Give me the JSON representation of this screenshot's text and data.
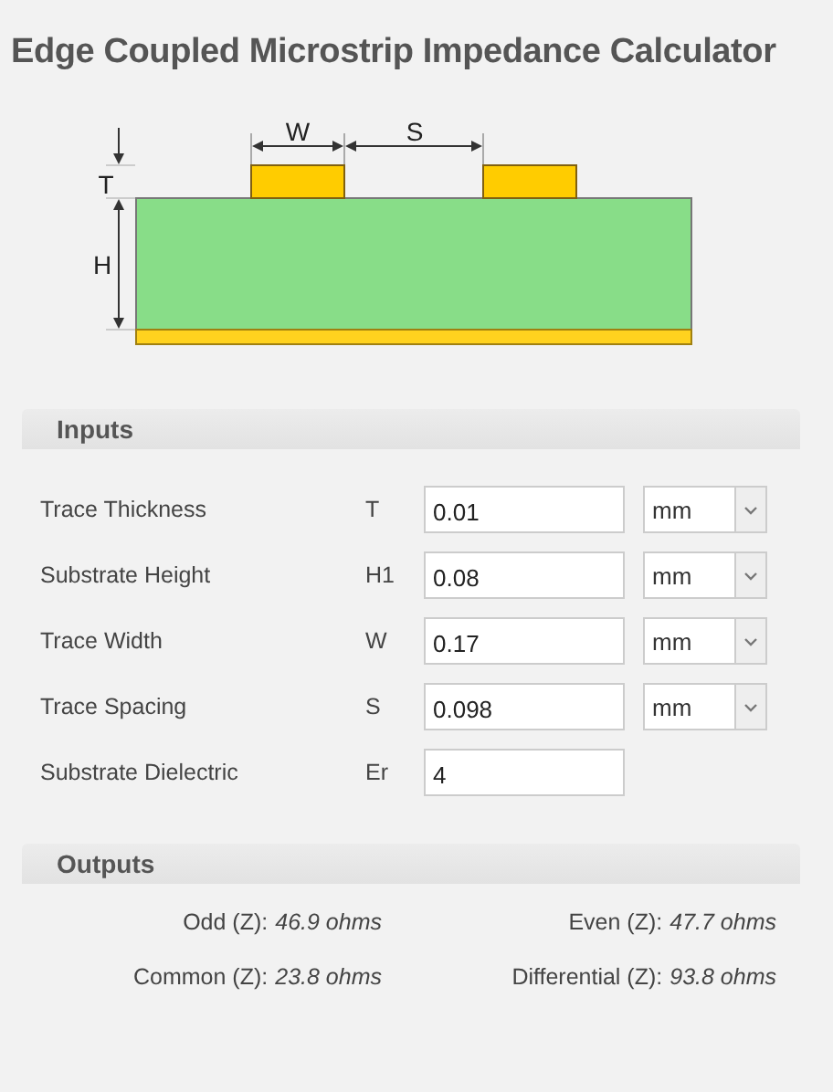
{
  "title": "Edge Coupled Microstrip Impedance Calculator",
  "diagram": {
    "w_label": "W",
    "s_label": "S",
    "t_label": "T",
    "h_label": "H"
  },
  "inputs": {
    "heading": "Inputs",
    "rows": [
      {
        "label": "Trace Thickness",
        "symbol": "T",
        "value": "0.01",
        "unit": "mm"
      },
      {
        "label": "Substrate Height",
        "symbol": "H1",
        "value": "0.08",
        "unit": "mm"
      },
      {
        "label": "Trace Width",
        "symbol": "W",
        "value": "0.17",
        "unit": "mm"
      },
      {
        "label": "Trace Spacing",
        "symbol": "S",
        "value": "0.098",
        "unit": "mm"
      },
      {
        "label": "Substrate Dielectric",
        "symbol": "Er",
        "value": "4"
      }
    ]
  },
  "outputs": {
    "heading": "Outputs",
    "items": [
      {
        "label": "Odd (Z):",
        "value": "46.9 ohms"
      },
      {
        "label": "Even (Z):",
        "value": "47.7 ohms"
      },
      {
        "label": "Common (Z):",
        "value": "23.8 ohms"
      },
      {
        "label": "Differential (Z):",
        "value": "93.8 ohms"
      }
    ]
  }
}
